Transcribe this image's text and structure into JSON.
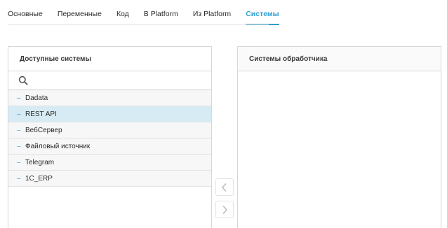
{
  "tabs": [
    {
      "label": "Основные"
    },
    {
      "label": "Переменные"
    },
    {
      "label": "Код"
    },
    {
      "label": "В Platform"
    },
    {
      "label": "Из Platform"
    },
    {
      "label": "Системы",
      "active": true
    }
  ],
  "available": {
    "title": "Доступные системы",
    "search": {
      "value": "",
      "placeholder": ""
    },
    "items": [
      {
        "label": "Dadata"
      },
      {
        "label": "REST API",
        "selected": true
      },
      {
        "label": "ВебСервер"
      },
      {
        "label": "Файловый источник"
      },
      {
        "label": "Telegram"
      },
      {
        "label": "1C_ERP"
      }
    ],
    "item_marker": "–"
  },
  "handler": {
    "title": "Системы обработчика",
    "items": []
  },
  "icons": {
    "search": "search-icon",
    "move_left": "chevron-left-icon",
    "move_right": "chevron-right-icon"
  },
  "colors": {
    "accent": "#2e9fd0",
    "selected_row": "#d6ebf3",
    "row_bg": "#f7f7f7",
    "border": "#d7d7d7"
  }
}
